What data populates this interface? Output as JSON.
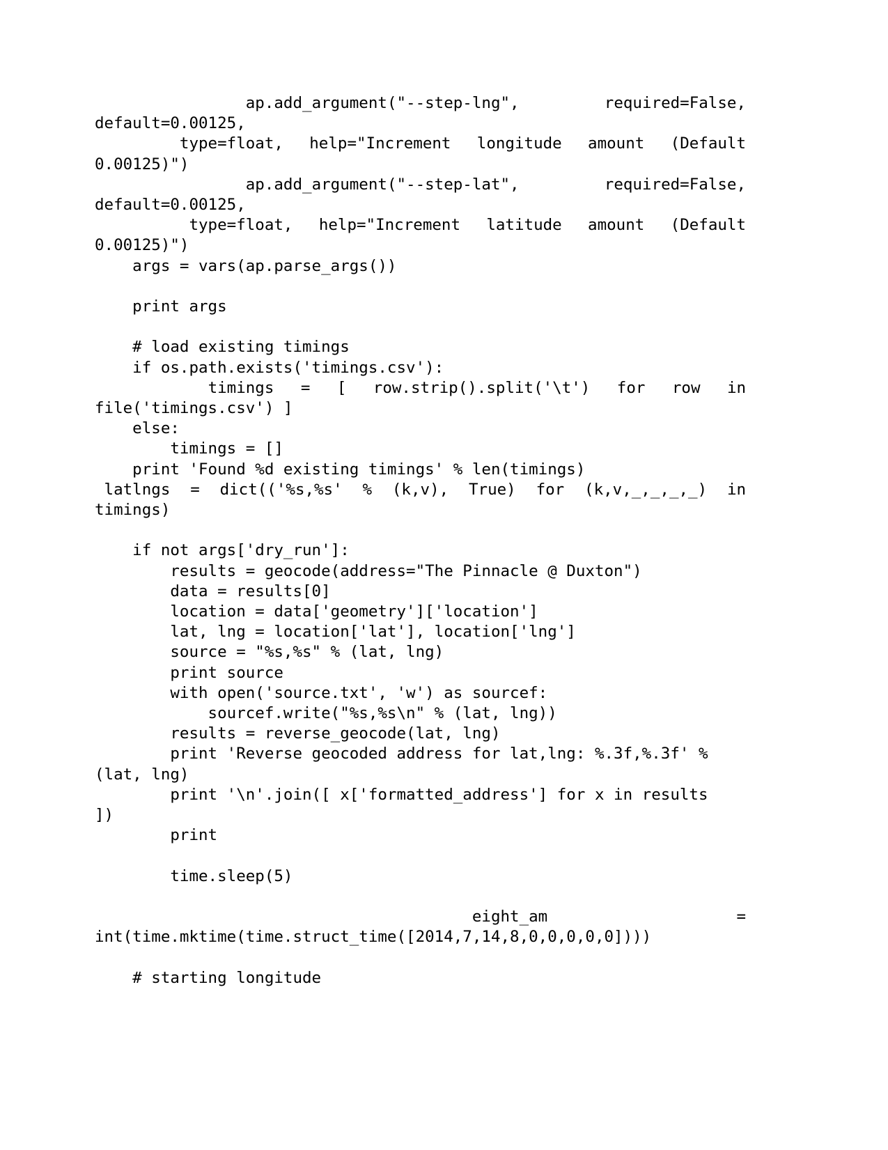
{
  "document": {
    "type": "code-listing",
    "language": "python",
    "page_background": "#ffffff",
    "text_color": "#000000",
    "lines": [
      {
        "id": "l1",
        "kind": "justified",
        "segments": [
          "ap.add_argument(\"--step-lng\",",
          "required=False,"
        ],
        "lead": "                "
      },
      {
        "id": "l2",
        "kind": "plain",
        "text": "default=0.00125,"
      },
      {
        "id": "l3",
        "kind": "justified",
        "segments": [
          "type=float,",
          "help=\"Increment",
          "longitude",
          "amount",
          "(Default"
        ],
        "lead": "         "
      },
      {
        "id": "l4",
        "kind": "plain",
        "text": "0.00125)\")"
      },
      {
        "id": "l5",
        "kind": "justified",
        "segments": [
          "ap.add_argument(\"--step-lat\",",
          "required=False,"
        ],
        "lead": "                "
      },
      {
        "id": "l6",
        "kind": "plain",
        "text": "default=0.00125,"
      },
      {
        "id": "l7",
        "kind": "justified",
        "segments": [
          "type=float,",
          "help=\"Increment",
          "latitude",
          "amount",
          "(Default"
        ],
        "lead": "          "
      },
      {
        "id": "l8",
        "kind": "plain",
        "text": "0.00125)\")"
      },
      {
        "id": "l9",
        "kind": "plain",
        "text": "    args = vars(ap.parse_args())"
      },
      {
        "id": "l10",
        "kind": "blank",
        "text": ""
      },
      {
        "id": "l11",
        "kind": "plain",
        "text": "    print args"
      },
      {
        "id": "l12",
        "kind": "blank",
        "text": ""
      },
      {
        "id": "l13",
        "kind": "plain",
        "text": "    # load existing timings"
      },
      {
        "id": "l14",
        "kind": "plain",
        "text": "    if os.path.exists('timings.csv'):"
      },
      {
        "id": "l15",
        "kind": "justified",
        "segments": [
          "timings",
          "=",
          "[",
          "row.strip().split('\\t')",
          "for",
          "row",
          "in"
        ],
        "lead": "            "
      },
      {
        "id": "l16",
        "kind": "plain",
        "text": "file('timings.csv') ]"
      },
      {
        "id": "l17",
        "kind": "plain",
        "text": "    else:"
      },
      {
        "id": "l18",
        "kind": "plain",
        "text": "        timings = []"
      },
      {
        "id": "l19",
        "kind": "plain",
        "text": "    print 'Found %d existing timings' % len(timings)"
      },
      {
        "id": "l20",
        "kind": "justified",
        "segments": [
          "latlngs",
          "=",
          "dict(('%s,%s'",
          "%",
          "(k,v),",
          "True)",
          "for",
          "(k,v,_,_,_,_)",
          "in"
        ],
        "lead": " "
      },
      {
        "id": "l21",
        "kind": "plain",
        "text": "timings)"
      },
      {
        "id": "l22",
        "kind": "blank",
        "text": ""
      },
      {
        "id": "l23",
        "kind": "plain",
        "text": "    if not args['dry_run']:"
      },
      {
        "id": "l24",
        "kind": "plain",
        "text": "        results = geocode(address=\"The Pinnacle @ Duxton\")"
      },
      {
        "id": "l25",
        "kind": "plain",
        "text": "        data = results[0]"
      },
      {
        "id": "l26",
        "kind": "plain",
        "text": "        location = data['geometry']['location']"
      },
      {
        "id": "l27",
        "kind": "plain",
        "text": "        lat, lng = location['lat'], location['lng']"
      },
      {
        "id": "l28",
        "kind": "plain",
        "text": "        source = \"%s,%s\" % (lat, lng)"
      },
      {
        "id": "l29",
        "kind": "plain",
        "text": "        print source"
      },
      {
        "id": "l30",
        "kind": "plain",
        "text": "        with open('source.txt', 'w') as sourcef:"
      },
      {
        "id": "l31",
        "kind": "plain",
        "text": "            sourcef.write(\"%s,%s\\n\" % (lat, lng))"
      },
      {
        "id": "l32",
        "kind": "plain",
        "text": "        results = reverse_geocode(lat, lng)"
      },
      {
        "id": "l33",
        "kind": "plain",
        "text": "        print 'Reverse geocoded address for lat,lng: %.3f,%.3f' %"
      },
      {
        "id": "l34",
        "kind": "plain",
        "text": "(lat, lng)"
      },
      {
        "id": "l35",
        "kind": "plain",
        "text": "        print '\\n'.join([ x['formatted_address'] for x in results"
      },
      {
        "id": "l36",
        "kind": "plain",
        "text": "])"
      },
      {
        "id": "l37",
        "kind": "plain",
        "text": "        print"
      },
      {
        "id": "l38",
        "kind": "blank",
        "text": ""
      },
      {
        "id": "l39",
        "kind": "plain",
        "text": "        time.sleep(5)"
      },
      {
        "id": "l40",
        "kind": "blank",
        "text": ""
      },
      {
        "id": "l41",
        "kind": "justified",
        "segments": [
          "eight_am",
          "="
        ],
        "lead": "                                        "
      },
      {
        "id": "l42",
        "kind": "plain",
        "text": "int(time.mktime(time.struct_time([2014,7,14,8,0,0,0,0,0])))"
      },
      {
        "id": "l43",
        "kind": "blank",
        "text": ""
      },
      {
        "id": "l44",
        "kind": "plain",
        "text": "    # starting longitude"
      }
    ]
  }
}
